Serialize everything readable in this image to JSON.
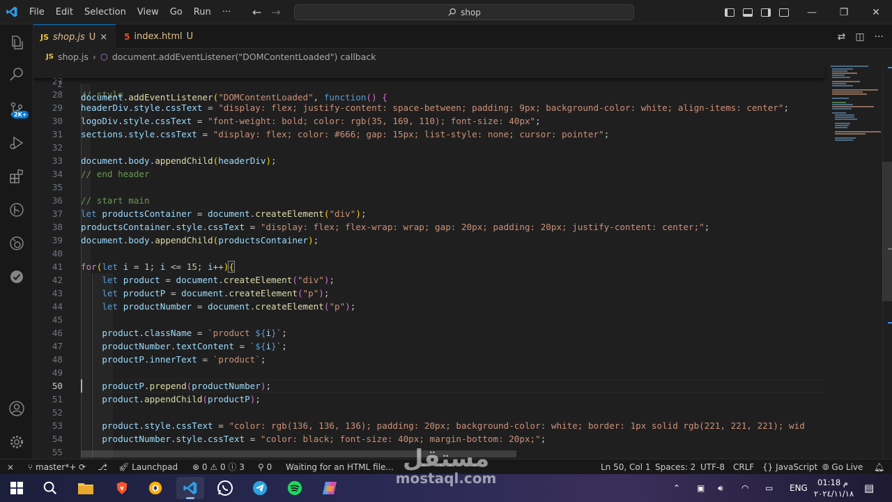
{
  "menu": [
    "File",
    "Edit",
    "Selection",
    "View",
    "Go",
    "Run",
    "···"
  ],
  "search": {
    "text": "shop"
  },
  "tabs": [
    {
      "name": "shop.js",
      "modified": "U",
      "close": "×"
    },
    {
      "name": "index.html",
      "modified": "U"
    }
  ],
  "breadcrumb": {
    "file": "shop.js",
    "separator": "›",
    "symbol": "document.addEventListener(\"DOMContentLoaded\") callback"
  },
  "activity": {
    "badge": "2K+"
  },
  "editor": {
    "sticky": {
      "num": "2"
    },
    "lines": [
      {
        "num": "27"
      },
      {
        "num": "28"
      },
      {
        "num": "29"
      },
      {
        "num": "30"
      },
      {
        "num": "31"
      },
      {
        "num": "32"
      },
      {
        "num": "33"
      },
      {
        "num": "34"
      },
      {
        "num": "35"
      },
      {
        "num": "36"
      },
      {
        "num": "37"
      },
      {
        "num": "38"
      },
      {
        "num": "39"
      },
      {
        "num": "40"
      },
      {
        "num": "41"
      },
      {
        "num": "42"
      },
      {
        "num": "43"
      },
      {
        "num": "44"
      },
      {
        "num": "45"
      },
      {
        "num": "46"
      },
      {
        "num": "47"
      },
      {
        "num": "48"
      },
      {
        "num": "49"
      },
      {
        "num": "50"
      },
      {
        "num": "51"
      },
      {
        "num": "52"
      },
      {
        "num": "53"
      },
      {
        "num": "54"
      },
      {
        "num": "55"
      }
    ]
  },
  "status": {
    "branch": "master*+",
    "launchpad": "Launchpad",
    "errors": "0",
    "warnings": "0",
    "infos": "3",
    "ports": "0",
    "message": "Waiting for an HTML file...",
    "position": "Ln 50, Col 1",
    "spaces": "Spaces: 2",
    "encoding": "UTF-8",
    "eol": "CRLF",
    "language": "JavaScript",
    "golive": "Go Live"
  },
  "watermark": {
    "arabic": "مستقل",
    "latin": "mostaql.com"
  },
  "tray": {
    "lang": "ENG",
    "time": "01:18 م",
    "date": "٢٠٢٤/١١/١٨"
  },
  "colors": {
    "accent": "#0078d4",
    "background": "#1f1f1f",
    "keyword": "#569cd6",
    "string": "#ce9178",
    "function": "#dcdcaa",
    "comment": "#6a9955"
  }
}
